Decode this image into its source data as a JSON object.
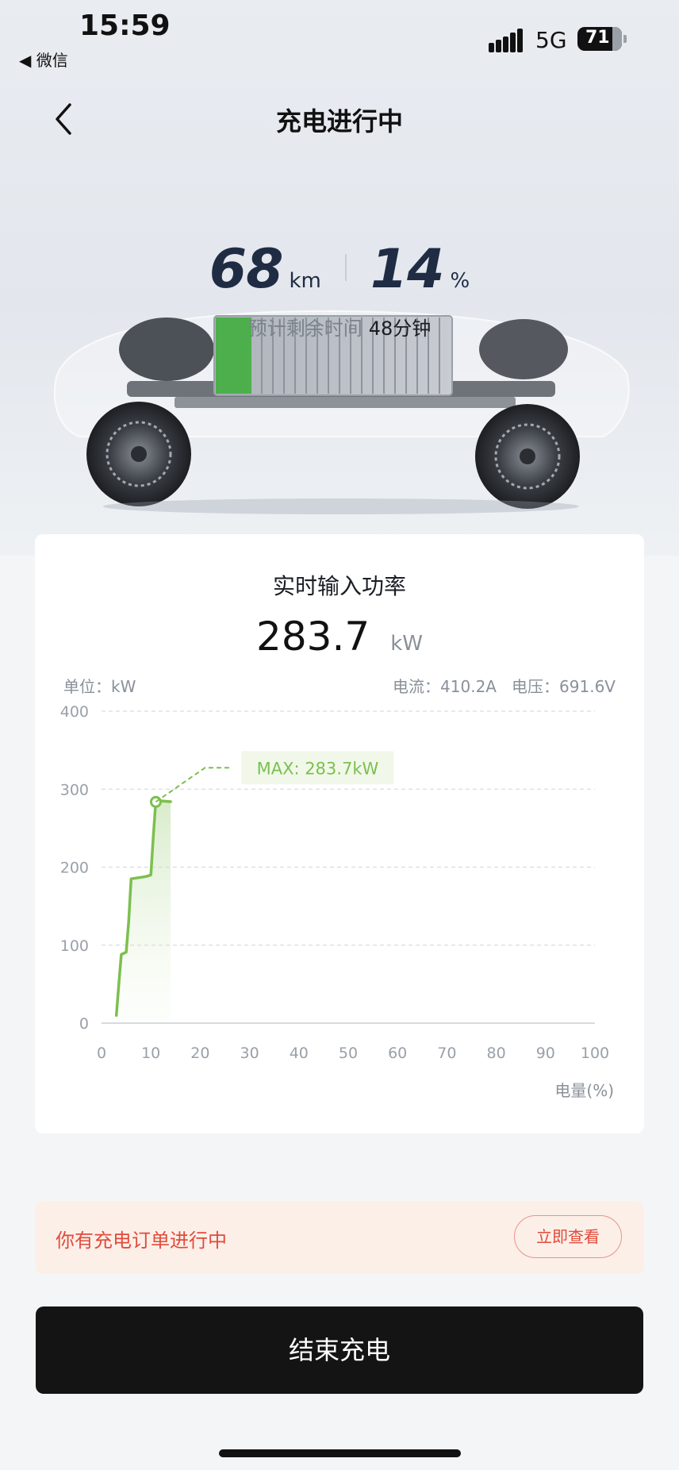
{
  "status_bar": {
    "time": "15:59",
    "back_app": "◀ 微信",
    "network": "5G",
    "battery": "71"
  },
  "header": {
    "title": "充电进行中",
    "back_icon": "chevron-left-icon"
  },
  "stats": {
    "range_value": "68",
    "range_unit": "km",
    "soc_value": "14",
    "soc_unit": "%",
    "eta_label": "预计剩余时间",
    "eta_value": "48分钟"
  },
  "card": {
    "title": "实时输入功率",
    "power_value": "283.7",
    "power_unit": "kW",
    "unit_label": "单位：kW",
    "current_voltage": "电流：410.2A   电压：691.6V"
  },
  "chart_data": {
    "type": "line",
    "xlabel": "电量(%)",
    "ylabel": "单位：kW",
    "xlim": [
      0,
      100
    ],
    "ylim": [
      0,
      400
    ],
    "x_ticks": [
      "0",
      "10",
      "20",
      "30",
      "40",
      "50",
      "60",
      "70",
      "80",
      "90",
      "100"
    ],
    "y_ticks": [
      "0",
      "100",
      "200",
      "300",
      "400"
    ],
    "grid": true,
    "color": "#7cbf4f",
    "series": [
      {
        "x": [
          3,
          3.5,
          4,
          5,
          5.5,
          6,
          9,
          10,
          10.5,
          11,
          12,
          14
        ],
        "y": [
          10,
          50,
          88,
          91,
          130,
          185,
          188,
          190,
          240,
          285,
          285,
          284
        ]
      }
    ],
    "max_annotation": "MAX: 283.7kW",
    "max_point": {
      "x": 11,
      "y": 283.7
    }
  },
  "banner": {
    "text": "你有充电订单进行中",
    "button": "立即查看"
  },
  "end_button": "结束充电"
}
